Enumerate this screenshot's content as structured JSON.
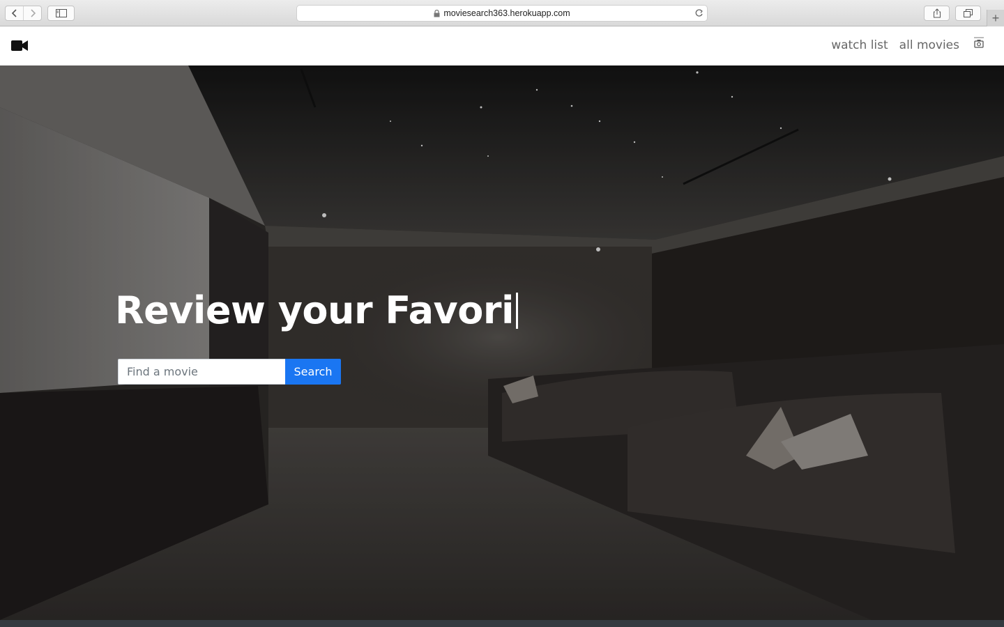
{
  "browser": {
    "url": "moviesearch363.herokuapp.com"
  },
  "navbar": {
    "brand_icon": "video-camera-icon",
    "links": [
      "watch list",
      "all movies"
    ],
    "avatar_icon": "camera-icon"
  },
  "hero": {
    "headline": "Review your Favori",
    "search": {
      "placeholder": "Find a movie",
      "value": "",
      "button_label": "Search"
    }
  },
  "colors": {
    "accent": "#1a76f2",
    "navbar_bg": "#ffffff",
    "nav_text": "#666666",
    "footer": "#343a40"
  }
}
